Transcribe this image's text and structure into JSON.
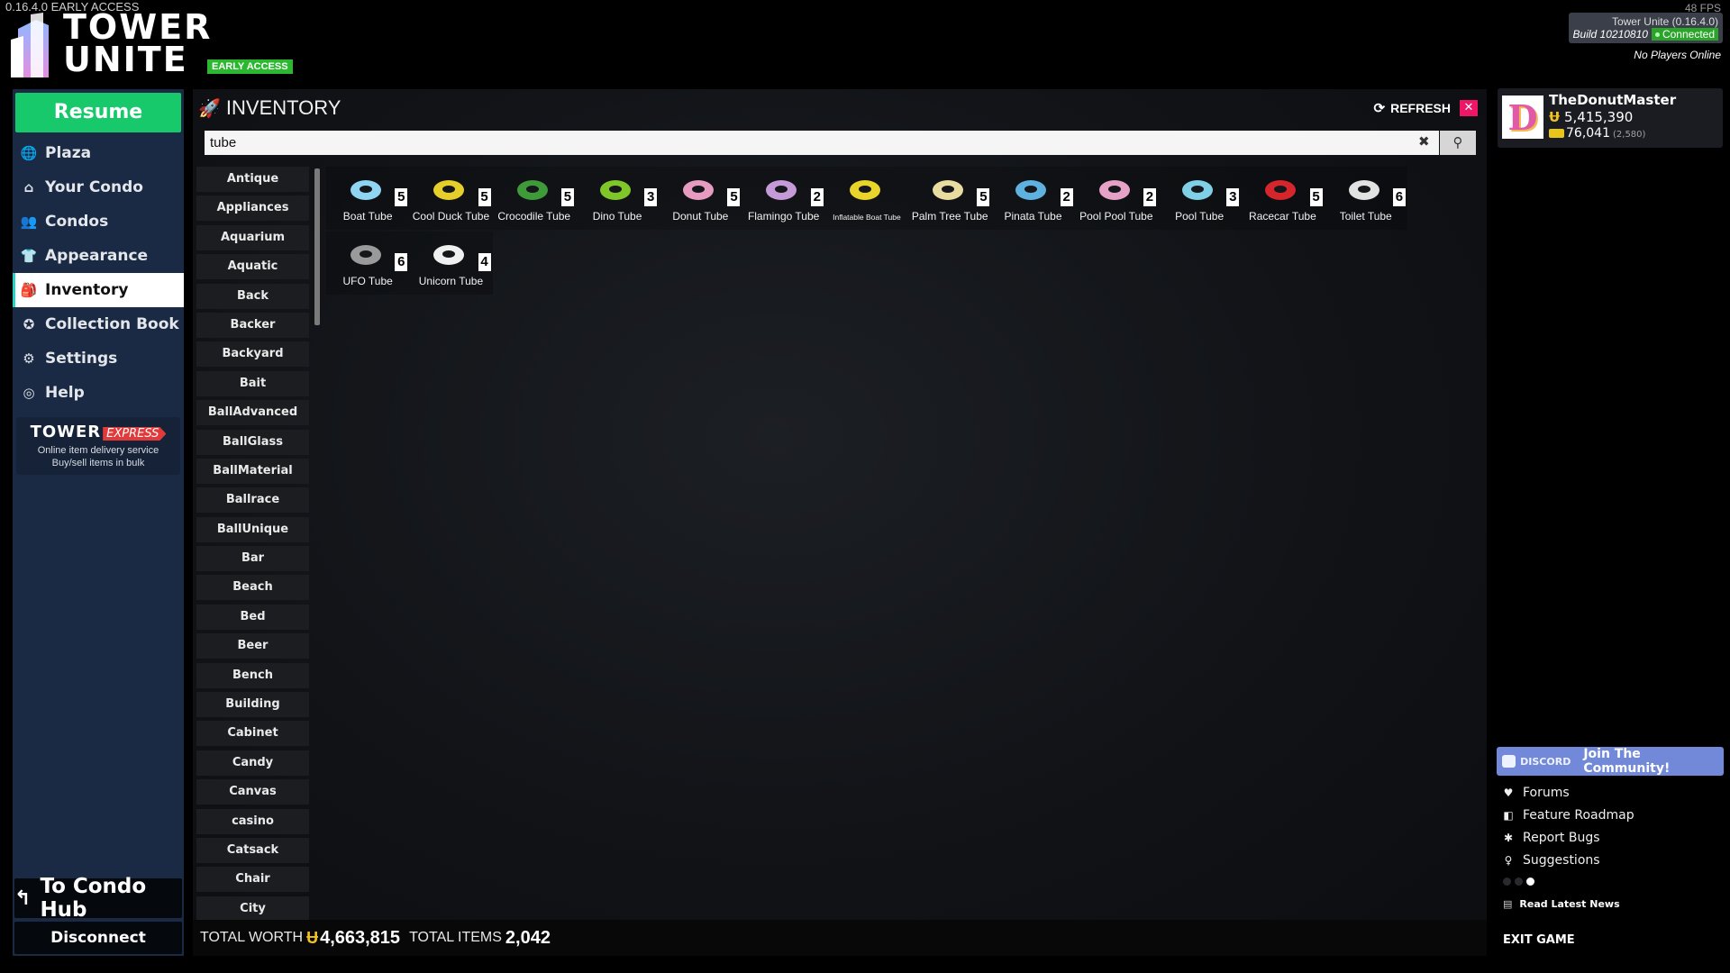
{
  "version": "0.16.4.0 EARLY ACCESS",
  "brand": {
    "line1": "TOWER",
    "line2": "UNITE",
    "badge": "EARLY ACCESS"
  },
  "status": {
    "fps": "48 FPS",
    "game": "Tower Unite (0.16.4.0)",
    "build": "Build 10210810",
    "connection": "Connected",
    "players": "No Players Online"
  },
  "nav": {
    "resume": "Resume",
    "items": [
      {
        "label": "Plaza",
        "icon": "globe-icon",
        "glyph": "🌐"
      },
      {
        "label": "Your Condo",
        "icon": "home-icon",
        "glyph": "⌂"
      },
      {
        "label": "Condos",
        "icon": "users-icon",
        "glyph": "👥"
      },
      {
        "label": "Appearance",
        "icon": "shirt-icon",
        "glyph": "👕"
      },
      {
        "label": "Inventory",
        "icon": "backpack-icon",
        "glyph": "🎒"
      },
      {
        "label": "Collection Book",
        "icon": "star-circle-icon",
        "glyph": "✪"
      },
      {
        "label": "Settings",
        "icon": "gear-icon",
        "glyph": "⚙"
      },
      {
        "label": "Help",
        "icon": "lifebuoy-icon",
        "glyph": "◎"
      }
    ],
    "active": "Inventory",
    "express": {
      "logo": "TOWER",
      "tag": "EXPRESS",
      "line1": "Online item delivery service",
      "line2": "Buy/sell items in bulk"
    },
    "to_condo_hub": "To Condo Hub",
    "disconnect": "Disconnect"
  },
  "inventory": {
    "title": "INVENTORY",
    "refresh": "REFRESH",
    "search_value": "tube",
    "categories": [
      "Antique",
      "Appliances",
      "Aquarium",
      "Aquatic",
      "Back",
      "Backer",
      "Backyard",
      "Bait",
      "BallAdvanced",
      "BallGlass",
      "BallMaterial",
      "Ballrace",
      "BallUnique",
      "Bar",
      "Beach",
      "Bed",
      "Beer",
      "Bench",
      "Building",
      "Cabinet",
      "Candy",
      "Canvas",
      "casino",
      "Catsack",
      "Chair",
      "City"
    ],
    "items": [
      {
        "name": "Boat Tube",
        "qty": "5",
        "color": "#8fd4f0"
      },
      {
        "name": "Cool Duck Tube",
        "qty": "5",
        "color": "#e6cf2b"
      },
      {
        "name": "Crocodile Tube",
        "qty": "5",
        "color": "#3f9a3a"
      },
      {
        "name": "Dino Tube",
        "qty": "3",
        "color": "#7fc62a"
      },
      {
        "name": "Donut Tube",
        "qty": "5",
        "color": "#e79bc0"
      },
      {
        "name": "Flamingo Tube",
        "qty": "2",
        "color": "#c59ad9"
      },
      {
        "name": "Inflatable Boat Tube",
        "qty": "",
        "color": "#e9d42a"
      },
      {
        "name": "Palm Tree Tube",
        "qty": "5",
        "color": "#e8dca0"
      },
      {
        "name": "Pinata Tube",
        "qty": "2",
        "color": "#5fb2e0"
      },
      {
        "name": "Pool Pool Tube",
        "qty": "2",
        "color": "#e6a2c6"
      },
      {
        "name": "Pool Tube",
        "qty": "3",
        "color": "#7fd0e6"
      },
      {
        "name": "Racecar Tube",
        "qty": "5",
        "color": "#d6262c"
      },
      {
        "name": "Toilet Tube",
        "qty": "6",
        "color": "#e2e2e2"
      },
      {
        "name": "UFO Tube",
        "qty": "6",
        "color": "#9a9a9a"
      },
      {
        "name": "Unicorn Tube",
        "qty": "4",
        "color": "#f0f0f0"
      }
    ],
    "total_worth_label": "TOTAL WORTH",
    "total_worth": "4,663,815",
    "total_items_label": "TOTAL ITEMS",
    "total_items": "2,042"
  },
  "profile": {
    "name": "TheDonutMaster",
    "coins": "5,415,390",
    "tickets": "76,041",
    "tickets_sub": "(2,580)",
    "avatar_letter": "D"
  },
  "community": {
    "discord_label": "DISCORD",
    "discord_cta": "Join The Community!",
    "links": [
      {
        "label": "Forums",
        "icon": "heart-icon",
        "glyph": "♥"
      },
      {
        "label": "Feature Roadmap",
        "icon": "trello-icon",
        "glyph": "◧"
      },
      {
        "label": "Report Bugs",
        "icon": "bug-icon",
        "glyph": "✱"
      },
      {
        "label": "Suggestions",
        "icon": "lightbulb-icon",
        "glyph": "♀"
      }
    ],
    "news": "Read Latest News",
    "exit": "EXIT GAME"
  },
  "colors": {
    "accent_green": "#17c96b",
    "nav_bg": "#1a2a44",
    "close_pink": "#ee1667",
    "discord": "#7289da",
    "coin": "#f2c221"
  }
}
